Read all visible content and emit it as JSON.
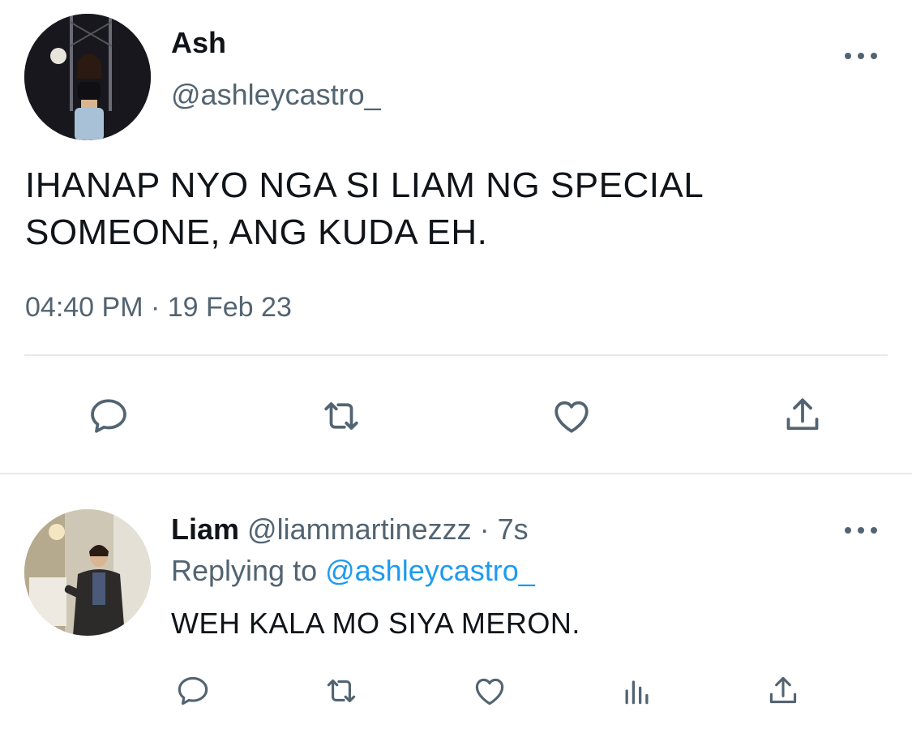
{
  "tweet": {
    "author_name": "Ash",
    "author_handle": "@ashleycastro_",
    "text_line1": "IHANAP NYO NGA SI LIAM NG SPECIAL",
    "text_line2": "SOMEONE, ANG KUDA EH.",
    "timestamp": "04:40 PM · 19 Feb 23",
    "actions": [
      "reply-icon",
      "retweet-icon",
      "like-icon",
      "share-icon"
    ]
  },
  "reply": {
    "author_name": "Liam",
    "author_handle": "@liammartinezzz",
    "separator": " · ",
    "time_ago": "7s",
    "replying_prefix": "Replying to ",
    "replying_to": "@ashleycastro_",
    "text": "WEH KALA MO SIYA MERON.",
    "actions": [
      "reply-icon",
      "retweet-icon",
      "like-icon",
      "views-icon",
      "share-icon"
    ]
  },
  "colors": {
    "text_primary": "#0f1419",
    "text_secondary": "#536471",
    "link": "#1d9bf0",
    "divider": "#e7e9ea"
  }
}
